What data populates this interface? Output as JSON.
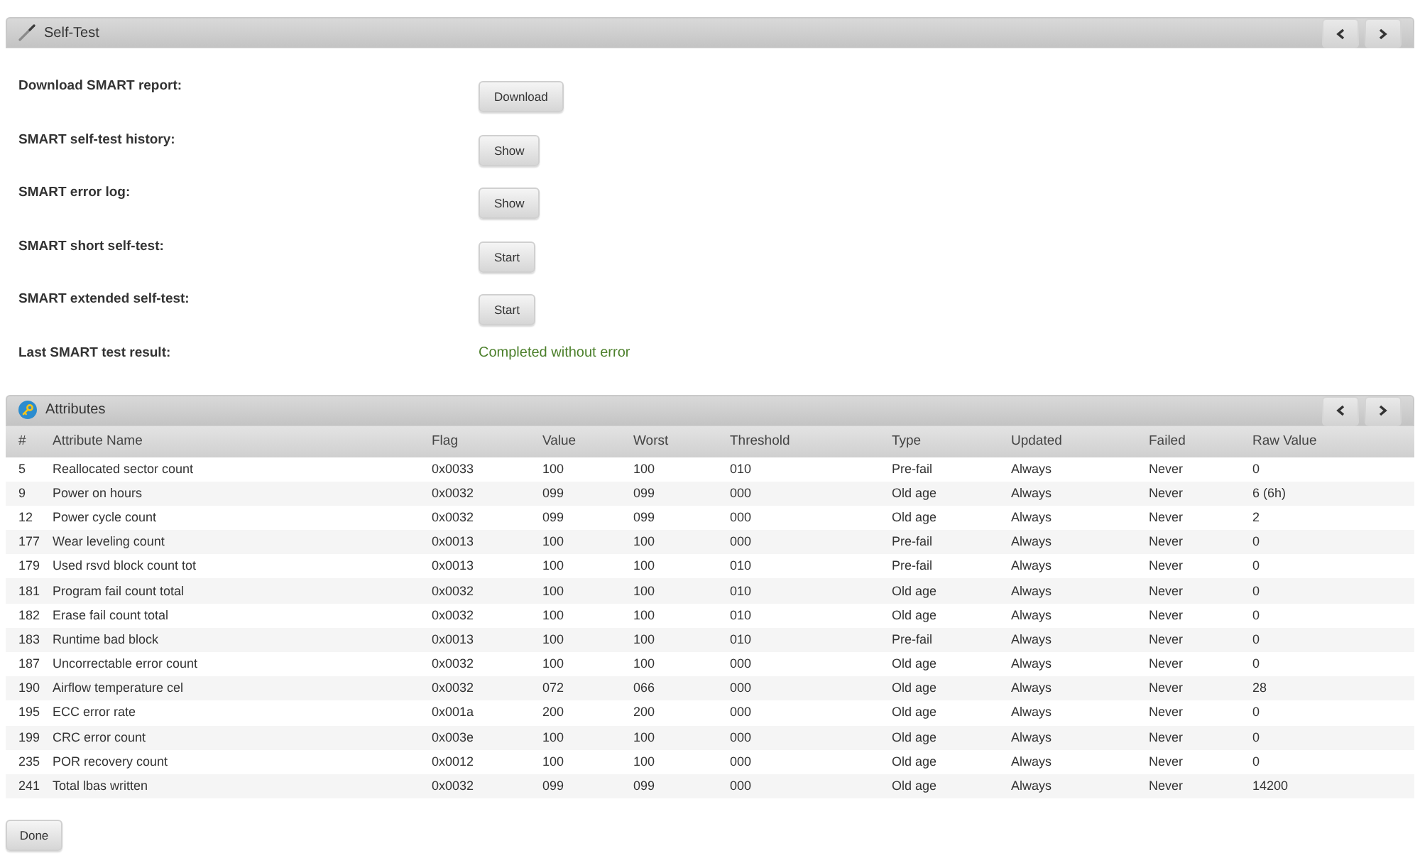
{
  "self_test": {
    "title": "Self-Test",
    "rows": [
      {
        "kind": "button",
        "label": "Download SMART report:",
        "button": "Download"
      },
      {
        "kind": "button",
        "label": "SMART self-test history:",
        "button": "Show"
      },
      {
        "kind": "button",
        "label": "SMART error log:",
        "button": "Show"
      },
      {
        "kind": "button",
        "label": "SMART short self-test:",
        "button": "Start"
      },
      {
        "kind": "button",
        "label": "SMART extended self-test:",
        "button": "Start"
      },
      {
        "kind": "result",
        "label": "Last SMART test result:",
        "value": "Completed without error"
      }
    ]
  },
  "attributes": {
    "title": "Attributes",
    "table": {
      "columns": [
        "#",
        "Attribute Name",
        "Flag",
        "Value",
        "Worst",
        "Threshold",
        "Type",
        "Updated",
        "Failed",
        "Raw Value"
      ],
      "rows": [
        [
          "5",
          "Reallocated sector count",
          "0x0033",
          "100",
          "100",
          "010",
          "Pre-fail",
          "Always",
          "Never",
          "0"
        ],
        [
          "9",
          "Power on hours",
          "0x0032",
          "099",
          "099",
          "000",
          "Old age",
          "Always",
          "Never",
          "6 (6h)"
        ],
        [
          "12",
          "Power cycle count",
          "0x0032",
          "099",
          "099",
          "000",
          "Old age",
          "Always",
          "Never",
          "2"
        ],
        [
          "177",
          "Wear leveling count",
          "0x0013",
          "100",
          "100",
          "000",
          "Pre-fail",
          "Always",
          "Never",
          "0"
        ],
        [
          "179",
          "Used rsvd block count tot",
          "0x0013",
          "100",
          "100",
          "010",
          "Pre-fail",
          "Always",
          "Never",
          "0"
        ],
        [
          "181",
          "Program fail count total",
          "0x0032",
          "100",
          "100",
          "010",
          "Old age",
          "Always",
          "Never",
          "0"
        ],
        [
          "182",
          "Erase fail count total",
          "0x0032",
          "100",
          "100",
          "010",
          "Old age",
          "Always",
          "Never",
          "0"
        ],
        [
          "183",
          "Runtime bad block",
          "0x0013",
          "100",
          "100",
          "010",
          "Pre-fail",
          "Always",
          "Never",
          "0"
        ],
        [
          "187",
          "Uncorrectable error count",
          "0x0032",
          "100",
          "100",
          "000",
          "Old age",
          "Always",
          "Never",
          "0"
        ],
        [
          "190",
          "Airflow temperature cel",
          "0x0032",
          "072",
          "066",
          "000",
          "Old age",
          "Always",
          "Never",
          "28"
        ],
        [
          "195",
          "ECC error rate",
          "0x001a",
          "200",
          "200",
          "000",
          "Old age",
          "Always",
          "Never",
          "0"
        ],
        [
          "199",
          "CRC error count",
          "0x003e",
          "100",
          "100",
          "000",
          "Old age",
          "Always",
          "Never",
          "0"
        ],
        [
          "235",
          "POR recovery count",
          "0x0012",
          "100",
          "100",
          "000",
          "Old age",
          "Always",
          "Never",
          "0"
        ],
        [
          "241",
          "Total lbas written",
          "0x0032",
          "099",
          "099",
          "000",
          "Old age",
          "Always",
          "Never",
          "14200"
        ]
      ]
    }
  },
  "done_button": "Done"
}
